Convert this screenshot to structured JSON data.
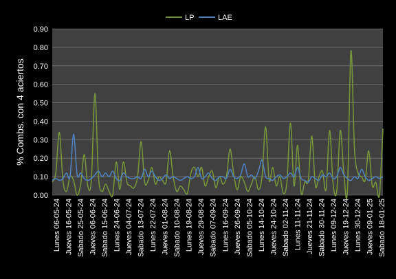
{
  "chart_data": {
    "type": "line",
    "title": "",
    "xlabel": "",
    "ylabel": "% Combs. con 4 aciertos",
    "ylim": [
      0,
      0.9
    ],
    "y_ticks": [
      "0.00",
      "0.10",
      "0.20",
      "0.30",
      "0.40",
      "0.50",
      "0.60",
      "0.70",
      "0.80",
      "0.90"
    ],
    "grid": "horizontal",
    "legend_position": "top-center",
    "background_color": "#000000",
    "plot_background_color": "#404040",
    "x_tick_labels": [
      "Lunes 06-05-24",
      "Jueves 16-05-24",
      "Sabado 25-05-24",
      "Jueves 06-06-24",
      "Sabado 15-06-24",
      "Lunes 24-06-24",
      "Jueves 04-07-24",
      "Sabado 13-07-24",
      "Lunes 22-07-24",
      "Jueves 01-08-24",
      "Sabado 10-08-24",
      "Lunes 19-08-24",
      "Jueves 29-08-24",
      "Sabado 07-09-24",
      "Lunes 16-09-24",
      "Jueves 26-09-24",
      "Sabado 05-10-24",
      "Lunes 14-10-24",
      "Jueves 24-10-24",
      "Sabado 02-11-24",
      "Lunes 11-11-24",
      "Jueves 21-11-24",
      "Sabado 30-11-24",
      "Lunes 09-12-24",
      "Jueves 19-12-24",
      "Lunes 30-12-24",
      "Jueves 09-01-25",
      "Sabado 18-01-25"
    ],
    "series": [
      {
        "name": "LP",
        "color": "#77933c",
        "values": [
          0.07,
          0.12,
          0.34,
          0.08,
          0.02,
          0.1,
          0.08,
          0.0,
          0.06,
          0.22,
          0.05,
          0.08,
          0.55,
          0.1,
          0.02,
          0.06,
          0.02,
          0.0,
          0.18,
          0.03,
          0.18,
          0.07,
          0.05,
          0.04,
          0.1,
          0.29,
          0.07,
          0.08,
          0.15,
          0.06,
          0.1,
          0.08,
          0.07,
          0.24,
          0.1,
          0.02,
          0.05,
          0.03,
          0.01,
          0.12,
          0.15,
          0.1,
          0.15,
          0.05,
          0.1,
          0.13,
          0.04,
          0.1,
          0.06,
          0.1,
          0.25,
          0.12,
          0.03,
          0.1,
          0.07,
          0.02,
          0.06,
          0.1,
          0.03,
          0.1,
          0.37,
          0.08,
          0.15,
          0.05,
          0.1,
          0.01,
          0.07,
          0.39,
          0.05,
          0.27,
          0.01,
          0.07,
          0.08,
          0.32,
          0.05,
          0.1,
          0.13,
          0.03,
          0.35,
          0.06,
          0.02,
          0.35,
          0.12,
          0.02,
          0.78,
          0.25,
          0.12,
          0.1,
          0.08,
          0.24,
          0.05,
          0.07,
          0.0,
          0.36
        ]
      },
      {
        "name": "LAE",
        "color": "#4f81bd",
        "values": [
          0.08,
          0.09,
          0.08,
          0.09,
          0.12,
          0.1,
          0.33,
          0.11,
          0.12,
          0.09,
          0.08,
          0.09,
          0.11,
          0.13,
          0.1,
          0.12,
          0.1,
          0.13,
          0.09,
          0.08,
          0.12,
          0.1,
          0.09,
          0.09,
          0.1,
          0.09,
          0.14,
          0.1,
          0.13,
          0.1,
          0.08,
          0.09,
          0.11,
          0.09,
          0.1,
          0.09,
          0.08,
          0.09,
          0.1,
          0.09,
          0.1,
          0.15,
          0.09,
          0.1,
          0.12,
          0.09,
          0.08,
          0.1,
          0.1,
          0.09,
          0.14,
          0.1,
          0.09,
          0.11,
          0.17,
          0.1,
          0.11,
          0.09,
          0.13,
          0.19,
          0.1,
          0.09,
          0.08,
          0.1,
          0.11,
          0.09,
          0.1,
          0.12,
          0.1,
          0.15,
          0.09,
          0.08,
          0.07,
          0.1,
          0.09,
          0.08,
          0.11,
          0.1,
          0.12,
          0.09,
          0.1,
          0.15,
          0.11,
          0.09,
          0.08,
          0.1,
          0.09,
          0.14,
          0.1,
          0.08,
          0.09,
          0.1,
          0.09,
          0.1
        ]
      }
    ]
  }
}
